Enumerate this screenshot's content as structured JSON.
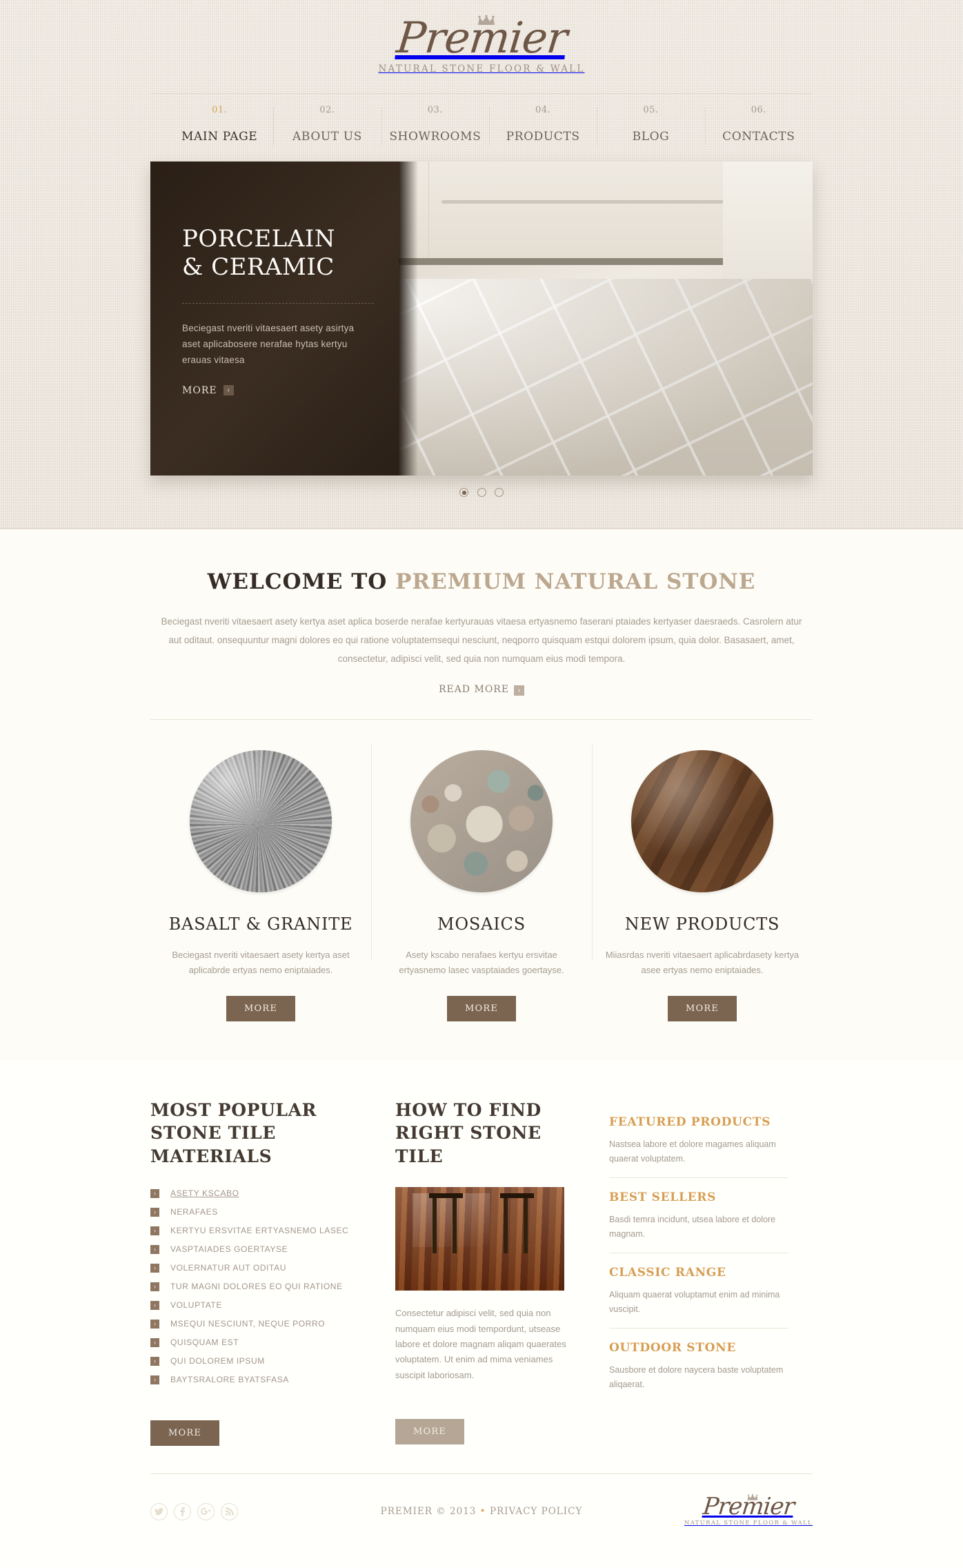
{
  "brand": {
    "name": "Premier",
    "tagline": "NATURAL STONE FLOOR & WALL",
    "crown_icon": "crown-icon",
    "accent_color": "#d79e53",
    "brown_color": "#7b6450"
  },
  "nav": {
    "items": [
      {
        "num": "01.",
        "label": "MAIN PAGE",
        "active": true
      },
      {
        "num": "02.",
        "label": "ABOUT US",
        "active": false
      },
      {
        "num": "03.",
        "label": "SHOWROOMS",
        "active": false
      },
      {
        "num": "04.",
        "label": "PRODUCTS",
        "active": false
      },
      {
        "num": "05.",
        "label": "BLOG",
        "active": false
      },
      {
        "num": "06.",
        "label": "CONTACTS",
        "active": false
      }
    ]
  },
  "slider": {
    "title_line1": "PORCELAIN",
    "title_line2": "& CERAMIC",
    "text": "Beciegast nveriti vitaesaert asety asirtya aset aplicabosere nerafae hytas kertyu erauas vitaesa",
    "more_label": "MORE",
    "arrow_glyph": "›",
    "slides_total": 3,
    "active_slide": 1
  },
  "welcome": {
    "heading_plain": "WELCOME TO ",
    "heading_accent": "PREMIUM NATURAL STONE",
    "paragraph": "Beciegast nveriti vitaesaert asety kertya aset aplica boserde nerafae kertyurauas vitaesa ertyasnemo faserani ptaiades kertyaser daesraeds. Casrolern atur aut oditaut. onsequuntur magni dolores eo qui ratione voluptatemsequi nesciunt, neqporro quisquam estqui dolorem ipsum, quia dolor. Basasaert, amet, consectetur, adipisci velit, sed quia non numquam eius modi tempora.",
    "read_more_label": "READ MORE"
  },
  "categories": [
    {
      "title": "BASALT & GRANITE",
      "text": "Beciegast nveriti vitaesaert asety kertya aset aplicabrde ertyas nemo eniptaiades.",
      "button": "MORE",
      "image": "granite-texture"
    },
    {
      "title": "MOSAICS",
      "text": "Asety kscabo nerafaes kertyu ersvitae ertyasnemo lasec vasptaiades goertayse.",
      "button": "MORE",
      "image": "mosaic-texture"
    },
    {
      "title": "NEW PRODUCTS",
      "text": "Miiasrdas nveriti vitaesaert aplicabrdasety kertya asee ertyas nemo eniptaiades.",
      "button": "MORE",
      "image": "marble-texture"
    }
  ],
  "popular": {
    "heading_line1": "MOST POPULAR",
    "heading_line2": "STONE TILE MATERIALS",
    "items": [
      {
        "label": "ASETY KSCABO",
        "current": true
      },
      {
        "label": "NERAFAES",
        "current": false
      },
      {
        "label": "KERTYU ERSVITAE ERTYASNEMO LASEC",
        "current": false
      },
      {
        "label": "VASPTAIADES GOERTAYSE",
        "current": false
      },
      {
        "label": "VOLERNATUR AUT ODITAU",
        "current": false
      },
      {
        "label": "TUR MAGNI DOLORES EO QUI RATIONE",
        "current": false
      },
      {
        "label": "VOLUPTATE",
        "current": false
      },
      {
        "label": "MSEQUI NESCIUNT, NEQUE PORRO",
        "current": false
      },
      {
        "label": "QUISQUAM EST",
        "current": false
      },
      {
        "label": "QUI DOLOREM IPSUM",
        "current": false
      },
      {
        "label": "BAYTSRALORE BYATSFASA",
        "current": false
      }
    ],
    "button": "MORE"
  },
  "howto": {
    "heading_line1": "HOW TO FIND",
    "heading_line2": "RIGHT STONE TILE",
    "image": "wood-floor-photo",
    "paragraph": "Consectetur adipisci velit, sed quia non numquam eius modi tempordunt, utsease labore et dolore magnam aliqam quaerates voluptatem. Ut enim ad mima veniames suscipit laboriosam.",
    "button": "MORE"
  },
  "featured": {
    "blocks": [
      {
        "title": "FEATURED PRODUCTS",
        "text": "Nastsea labore et dolore magames aliquam quaerat voluptatem."
      },
      {
        "title": "BEST SELLERS",
        "text": "Basdi temra incidunt, utsea labore et dolore magnam."
      },
      {
        "title": "CLASSIC RANGE",
        "text": "Aliquam quaerat voluptamut enim ad minima vuscipit."
      },
      {
        "title": "OUTDOOR STONE",
        "text": "Sausbore et dolore naycera baste voluptatem aliqaerat."
      }
    ]
  },
  "footer": {
    "socials": [
      {
        "name": "twitter-icon",
        "label": "Twitter"
      },
      {
        "name": "facebook-icon",
        "label": "Facebook"
      },
      {
        "name": "google-plus-icon",
        "label": "Google Plus"
      },
      {
        "name": "rss-icon",
        "label": "RSS"
      }
    ],
    "copyright": "PREMIER © 2013",
    "separator": "•",
    "privacy": "PRIVACY POLICY"
  }
}
